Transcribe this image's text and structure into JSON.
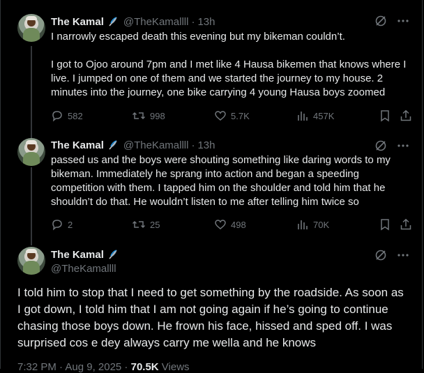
{
  "author": {
    "name": "The Kamal",
    "handle": "@TheKamallll"
  },
  "tweets": [
    {
      "time": "13h",
      "paragraphs": [
        "I narrowly escaped death this evening but my bikeman couldn’t.",
        "I got to Ojoo around 7pm and I met like 4 Hausa bikemen that knows where I live. I jumped on one of them and we started the journey to my house. 2 minutes into the journey, one bike carrying 4 young Hausa boys zoomed"
      ],
      "stats": {
        "replies": "582",
        "reposts": "998",
        "likes": "5.7K",
        "views": "457K"
      }
    },
    {
      "time": "13h",
      "paragraphs": [
        "passed us and the boys were shouting something like daring words to my bikeman. Immediately he sprang into action and began a speeding competition with them. I tapped him on the shoulder and told him that he shouldn’t do that. He wouldn’t listen to me after telling him twice so"
      ],
      "stats": {
        "replies": "2",
        "reposts": "25",
        "likes": "498",
        "views": "70K"
      }
    }
  ],
  "focused": {
    "text": "I told him to stop that I need to get something by the roadside. As soon as I got down, I told him that I am not going again if he’s going to continue chasing those boys down. He frown his face, hissed and sped off. I was surprised cos e dey always carry me wella and he knows",
    "footer_time": "7:32 PM · Aug 9, 2025 · ",
    "footer_views": "70.5K",
    "footer_views_label": " Views"
  },
  "colors": {
    "background": "#000000",
    "text": "#e7e9ea",
    "muted": "#71767b",
    "border": "#2f3336"
  }
}
